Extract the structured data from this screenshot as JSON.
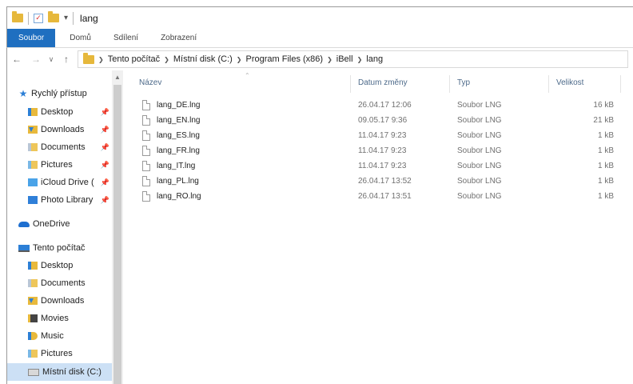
{
  "window": {
    "title": "lang"
  },
  "ribbon": {
    "tabs": [
      "Soubor",
      "Domů",
      "Sdílení",
      "Zobrazení"
    ]
  },
  "address": {
    "breadcrumb": [
      "Tento počítač",
      "Místní disk (C:)",
      "Program Files (x86)",
      "iBell",
      "lang"
    ]
  },
  "nav": {
    "quick_access": {
      "label": "Rychlý přístup",
      "items": [
        {
          "label": "Desktop",
          "icon": "desktop-folder-icon"
        },
        {
          "label": "Downloads",
          "icon": "downloads-folder-icon"
        },
        {
          "label": "Documents",
          "icon": "documents-folder-icon"
        },
        {
          "label": "Pictures",
          "icon": "pictures-folder-icon"
        },
        {
          "label": "iCloud Drive (",
          "icon": "icloud-folder-icon"
        },
        {
          "label": "Photo Library",
          "icon": "photo-library-icon"
        }
      ]
    },
    "onedrive": {
      "label": "OneDrive"
    },
    "this_pc": {
      "label": "Tento počítač",
      "items": [
        {
          "label": "Desktop"
        },
        {
          "label": "Documents"
        },
        {
          "label": "Downloads"
        },
        {
          "label": "Movies"
        },
        {
          "label": "Music"
        },
        {
          "label": "Pictures"
        },
        {
          "label": "Místní disk (C:)"
        }
      ]
    }
  },
  "files": {
    "columns": [
      "Název",
      "Datum změny",
      "Typ",
      "Velikost"
    ],
    "rows": [
      {
        "name": "lang_DE.lng",
        "date": "26.04.17 12:06",
        "type": "Soubor LNG",
        "size": "16 kB"
      },
      {
        "name": "lang_EN.lng",
        "date": "09.05.17 9:36",
        "type": "Soubor LNG",
        "size": "21 kB"
      },
      {
        "name": "lang_ES.lng",
        "date": "11.04.17 9:23",
        "type": "Soubor LNG",
        "size": "1 kB"
      },
      {
        "name": "lang_FR.lng",
        "date": "11.04.17 9:23",
        "type": "Soubor LNG",
        "size": "1 kB"
      },
      {
        "name": "lang_IT.lng",
        "date": "11.04.17 9:23",
        "type": "Soubor LNG",
        "size": "1 kB"
      },
      {
        "name": "lang_PL.lng",
        "date": "26.04.17 13:52",
        "type": "Soubor LNG",
        "size": "1 kB"
      },
      {
        "name": "lang_RO.lng",
        "date": "26.04.17 13:51",
        "type": "Soubor LNG",
        "size": "1 kB"
      }
    ]
  },
  "colors": {
    "accent": "#1f6fc0",
    "selection": "#cce0f5",
    "header_text": "#4d6a8a"
  }
}
